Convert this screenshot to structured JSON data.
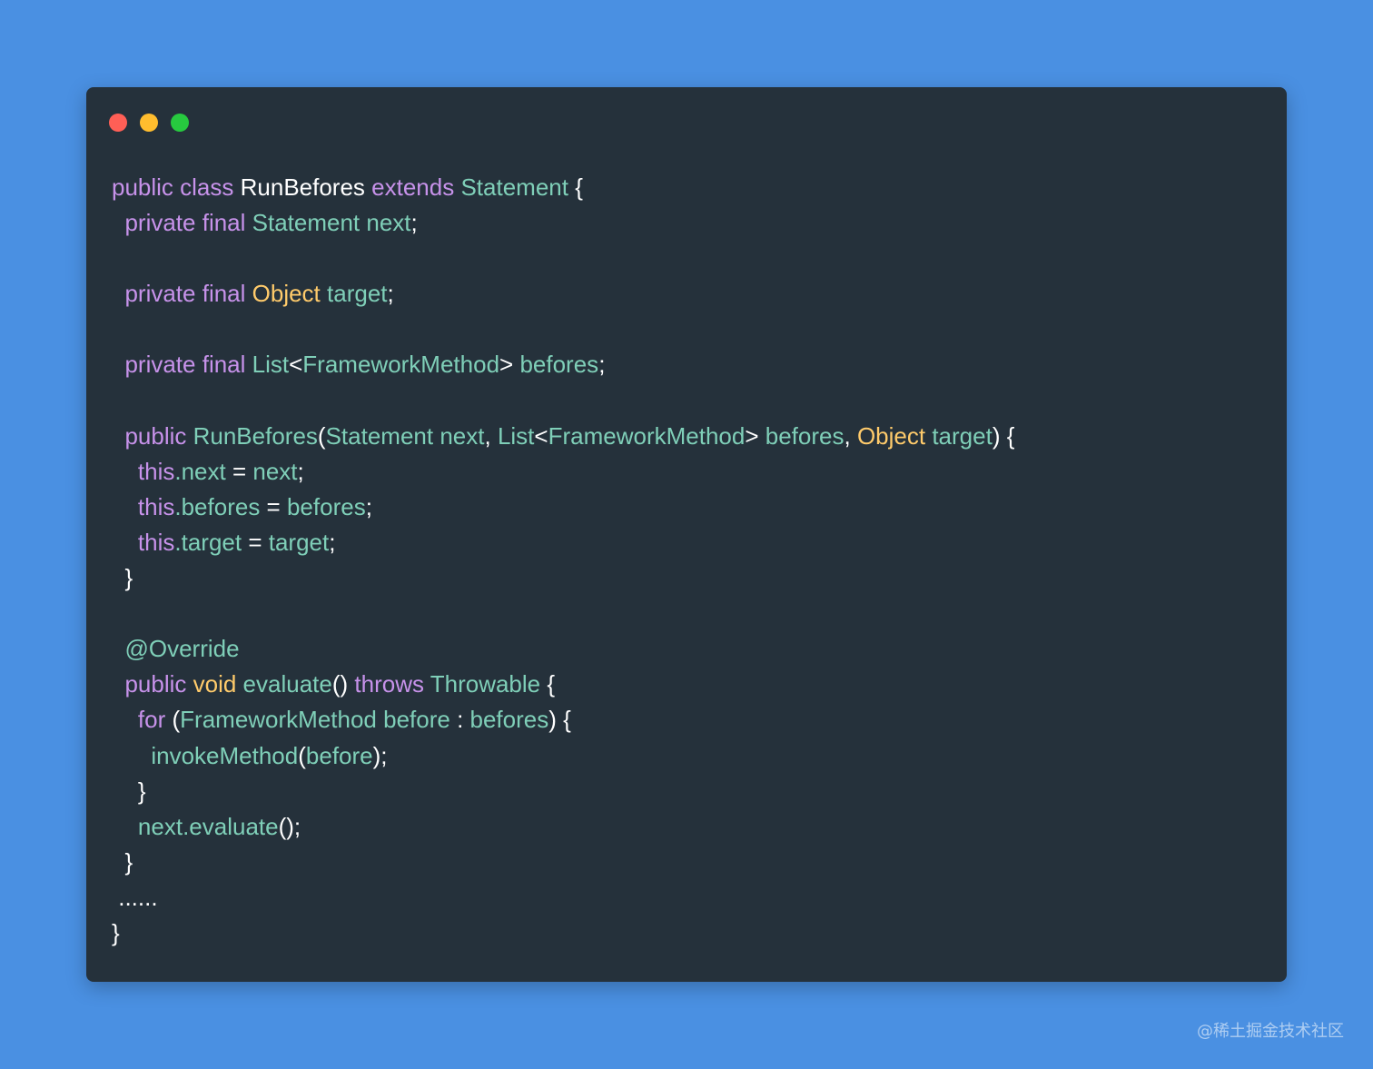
{
  "window": {
    "controls": [
      {
        "name": "close",
        "color": "#ff5f56"
      },
      {
        "name": "minimize",
        "color": "#ffbd2e"
      },
      {
        "name": "maximize",
        "color": "#27c93f"
      }
    ]
  },
  "code": {
    "lines": [
      {
        "indent": "",
        "tokens": [
          {
            "t": "public class ",
            "c": "kw"
          },
          {
            "t": "RunBefores ",
            "c": "pl"
          },
          {
            "t": "extends ",
            "c": "kw"
          },
          {
            "t": "Statement ",
            "c": "ty"
          },
          {
            "t": "{",
            "c": "pl"
          }
        ]
      },
      {
        "indent": "  ",
        "tokens": [
          {
            "t": "private final ",
            "c": "kw"
          },
          {
            "t": "Statement next",
            "c": "ty"
          },
          {
            "t": ";",
            "c": "pl"
          }
        ]
      },
      {
        "indent": "",
        "tokens": []
      },
      {
        "indent": "  ",
        "tokens": [
          {
            "t": "private final ",
            "c": "kw"
          },
          {
            "t": "Object ",
            "c": "yl"
          },
          {
            "t": "target",
            "c": "ty"
          },
          {
            "t": ";",
            "c": "pl"
          }
        ]
      },
      {
        "indent": "",
        "tokens": []
      },
      {
        "indent": "  ",
        "tokens": [
          {
            "t": "private final ",
            "c": "kw"
          },
          {
            "t": "List",
            "c": "ty"
          },
          {
            "t": "<",
            "c": "pl"
          },
          {
            "t": "FrameworkMethod",
            "c": "ty"
          },
          {
            "t": "> ",
            "c": "pl"
          },
          {
            "t": "befores",
            "c": "ty"
          },
          {
            "t": ";",
            "c": "pl"
          }
        ]
      },
      {
        "indent": "",
        "tokens": []
      },
      {
        "indent": "  ",
        "tokens": [
          {
            "t": "public ",
            "c": "kw"
          },
          {
            "t": "RunBefores",
            "c": "ty"
          },
          {
            "t": "(",
            "c": "pl"
          },
          {
            "t": "Statement next",
            "c": "ty"
          },
          {
            "t": ", ",
            "c": "pl"
          },
          {
            "t": "List",
            "c": "ty"
          },
          {
            "t": "<",
            "c": "pl"
          },
          {
            "t": "FrameworkMethod",
            "c": "ty"
          },
          {
            "t": "> ",
            "c": "pl"
          },
          {
            "t": "befores",
            "c": "ty"
          },
          {
            "t": ", ",
            "c": "pl"
          },
          {
            "t": "Object ",
            "c": "yl"
          },
          {
            "t": "target",
            "c": "ty"
          },
          {
            "t": ") {",
            "c": "pl"
          }
        ]
      },
      {
        "indent": "    ",
        "tokens": [
          {
            "t": "this",
            "c": "kw"
          },
          {
            "t": ".next",
            "c": "ty"
          },
          {
            "t": " = ",
            "c": "pl"
          },
          {
            "t": "next",
            "c": "ty"
          },
          {
            "t": ";",
            "c": "pl"
          }
        ]
      },
      {
        "indent": "    ",
        "tokens": [
          {
            "t": "this",
            "c": "kw"
          },
          {
            "t": ".befores",
            "c": "ty"
          },
          {
            "t": " = ",
            "c": "pl"
          },
          {
            "t": "befores",
            "c": "ty"
          },
          {
            "t": ";",
            "c": "pl"
          }
        ]
      },
      {
        "indent": "    ",
        "tokens": [
          {
            "t": "this",
            "c": "kw"
          },
          {
            "t": ".target",
            "c": "ty"
          },
          {
            "t": " = ",
            "c": "pl"
          },
          {
            "t": "target",
            "c": "ty"
          },
          {
            "t": ";",
            "c": "pl"
          }
        ]
      },
      {
        "indent": "  ",
        "tokens": [
          {
            "t": "}",
            "c": "pl"
          }
        ]
      },
      {
        "indent": "",
        "tokens": []
      },
      {
        "indent": "  ",
        "tokens": [
          {
            "t": "@Override",
            "c": "ty"
          }
        ]
      },
      {
        "indent": "  ",
        "tokens": [
          {
            "t": "public ",
            "c": "kw"
          },
          {
            "t": "void ",
            "c": "yl"
          },
          {
            "t": "evaluate",
            "c": "ty"
          },
          {
            "t": "() ",
            "c": "pl"
          },
          {
            "t": "throws ",
            "c": "kw"
          },
          {
            "t": "Throwable ",
            "c": "ty"
          },
          {
            "t": "{",
            "c": "pl"
          }
        ]
      },
      {
        "indent": "    ",
        "tokens": [
          {
            "t": "for ",
            "c": "kw"
          },
          {
            "t": "(",
            "c": "pl"
          },
          {
            "t": "FrameworkMethod before",
            "c": "ty"
          },
          {
            "t": " : ",
            "c": "pl"
          },
          {
            "t": "befores",
            "c": "ty"
          },
          {
            "t": ") {",
            "c": "pl"
          }
        ]
      },
      {
        "indent": "      ",
        "tokens": [
          {
            "t": "invokeMethod",
            "c": "ty"
          },
          {
            "t": "(",
            "c": "pl"
          },
          {
            "t": "before",
            "c": "ty"
          },
          {
            "t": ");",
            "c": "pl"
          }
        ]
      },
      {
        "indent": "    ",
        "tokens": [
          {
            "t": "}",
            "c": "pl"
          }
        ]
      },
      {
        "indent": "    ",
        "tokens": [
          {
            "t": "next",
            "c": "ty"
          },
          {
            "t": ".evaluate",
            "c": "ty"
          },
          {
            "t": "();",
            "c": "pl"
          }
        ]
      },
      {
        "indent": "  ",
        "tokens": [
          {
            "t": "}",
            "c": "pl"
          }
        ]
      },
      {
        "indent": " ",
        "tokens": [
          {
            "t": "......",
            "c": "pl"
          }
        ]
      },
      {
        "indent": "",
        "tokens": [
          {
            "t": "}",
            "c": "pl"
          }
        ]
      }
    ]
  },
  "watermark": "@稀土掘金技术社区"
}
